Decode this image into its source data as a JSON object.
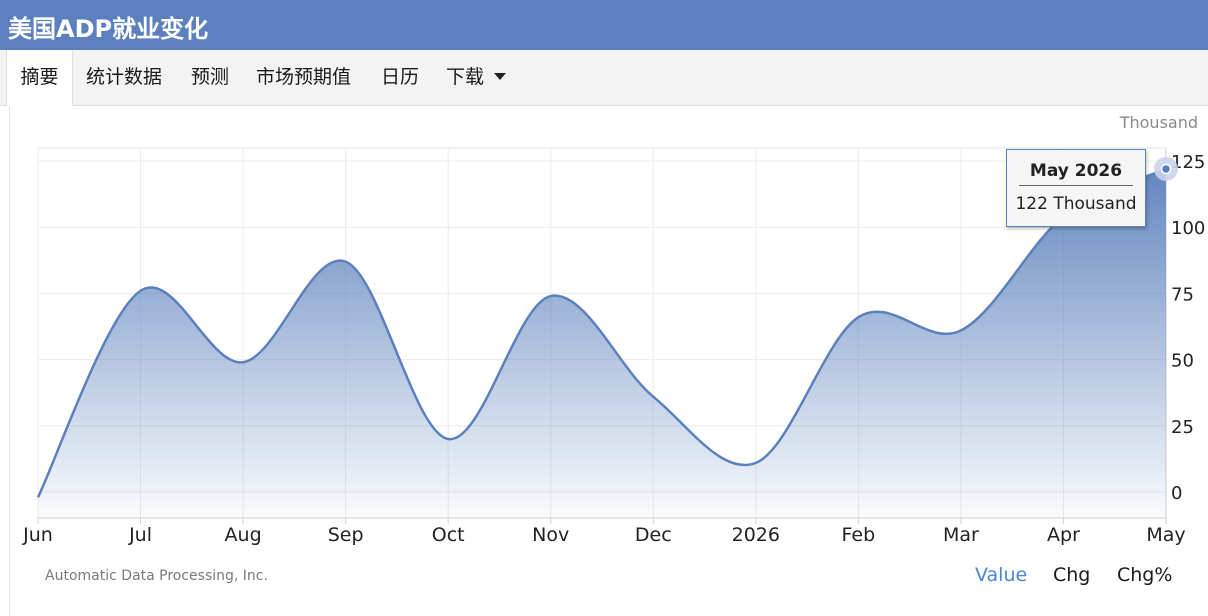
{
  "header": {
    "title": "美国ADP就业变化"
  },
  "tabs": [
    {
      "label": "摘要",
      "active": true
    },
    {
      "label": "统计数据",
      "active": false
    },
    {
      "label": "预测",
      "active": false
    },
    {
      "label": "市场预期值",
      "active": false
    },
    {
      "label": "日历",
      "active": false
    },
    {
      "label": "下载",
      "active": false,
      "dropdown": true
    }
  ],
  "unit": "Thousand",
  "source": "Automatic Data Processing, Inc.",
  "modes": [
    {
      "label": "Value",
      "active": true
    },
    {
      "label": "Chg",
      "active": false
    },
    {
      "label": "Chg%",
      "active": false
    }
  ],
  "tooltip": {
    "date": "May 2026",
    "value": "122 Thousand"
  },
  "colors": {
    "header_bg": "#5b80bd",
    "line": "#5b80bd",
    "fill_top": "#5b80bd",
    "active_mode": "#4a86d8"
  },
  "chart_data": {
    "type": "area",
    "x": [
      "Jun",
      "Jul",
      "Aug",
      "Sep",
      "Oct",
      "Nov",
      "Dec",
      "2026",
      "Feb",
      "Mar",
      "Apr",
      "May"
    ],
    "values": [
      -2,
      76,
      49,
      87,
      20,
      74,
      36,
      11,
      66,
      61,
      104,
      122
    ],
    "ylim": [
      0,
      125
    ],
    "yticks": [
      0,
      25,
      50,
      75,
      100,
      125
    ],
    "y_axis_side": "right",
    "grid": true,
    "highlight_index": 11
  }
}
